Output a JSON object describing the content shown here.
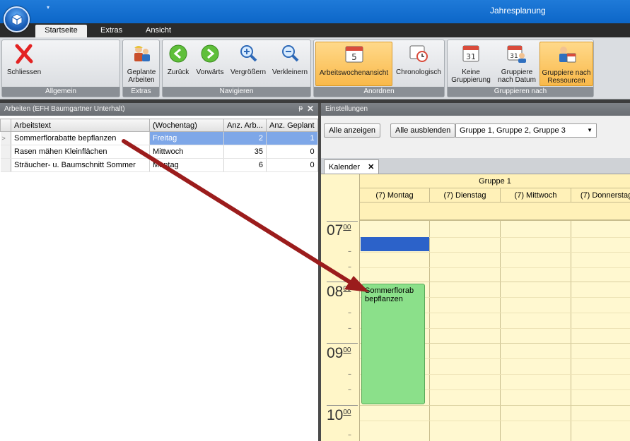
{
  "window": {
    "title": "Jahresplanung"
  },
  "tabs": [
    "Startseite",
    "Extras",
    "Ansicht"
  ],
  "ribbon": {
    "groups": {
      "allgemein": "Allgemein",
      "extras": "Extras",
      "navigieren": "Navigieren",
      "anordnen": "Anordnen",
      "gruppieren": "Gruppieren nach"
    },
    "buttons": {
      "schliessen": "Schliessen",
      "geplante_1": "Geplante",
      "geplante_2": "Arbeiten",
      "zurueck": "Zurück",
      "vorwaerts": "Vorwärts",
      "vergroessern": "Vergrößern",
      "verkleinern": "Verkleinern",
      "arbeitswoche": "Arbeitswochenansicht",
      "chronologisch": "Chronologisch",
      "keine_1": "Keine",
      "keine_2": "Gruppierung",
      "datum_1": "Gruppiere",
      "datum_2": "nach Datum",
      "ressourcen_1": "Gruppiere nach",
      "ressourcen_2": "Ressourcen",
      "calendar_5": "5",
      "calendar_31a": "31",
      "calendar_31b": "31"
    }
  },
  "left_panel": {
    "title": "Arbeiten (EFH Baumgartner Unterhalt)",
    "pin": "ᵽ",
    "close": "✕",
    "columns": [
      "Arbeitstext",
      "(Wochentag)",
      "Anz. Arb...",
      "Anz. Geplant"
    ],
    "rows": [
      {
        "text": "Sommerflorabatte bepflanzen",
        "day": "Freitag",
        "anz": "2",
        "geplant": "1"
      },
      {
        "text": "Rasen mähen Kleinflächen",
        "day": "Mittwoch",
        "anz": "35",
        "geplant": "0"
      },
      {
        "text": "Sträucher- u. Baumschnitt Sommer",
        "day": "Montag",
        "anz": "6",
        "geplant": "0"
      }
    ]
  },
  "settings": {
    "title": "Einstellungen",
    "show_all": "Alle anzeigen",
    "hide_all": "Alle ausblenden",
    "groups_value": "Gruppe 1, Gruppe 2, Gruppe 3"
  },
  "calendar": {
    "tab": "Kalender",
    "tab_close": "✕",
    "group": "Gruppe 1",
    "days": [
      "(7) Montag",
      "(7) Dienstag",
      "(7) Mittwoch",
      "(7) Donnerstag"
    ],
    "hours": [
      {
        "h": "07",
        "m": "00"
      },
      {
        "h": "08",
        "m": "00"
      },
      {
        "h": "09",
        "m": "00"
      },
      {
        "h": "10",
        "m": "00"
      }
    ],
    "appointment": "Sommerflorab bepflanzen"
  },
  "colors": {
    "titlebar": "#1f7ad8",
    "selection": "#7ea7e8",
    "appointment": "#8be08a",
    "arrow": "#9b1c1c",
    "active_button": "#f9b94a"
  }
}
